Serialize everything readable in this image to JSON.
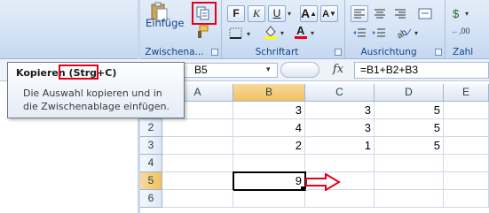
{
  "colors": {
    "ribbon": "#d4e3f6",
    "highlight": "#e3001b",
    "header_selected": "#f1c15f",
    "tooltip_border": "#767676"
  },
  "ribbon": {
    "clipboard": {
      "paste_label": "Einfüge",
      "group_label": "Zwischena..."
    },
    "font": {
      "group_label": "Schriftart",
      "bold": "F",
      "italic": "K",
      "underline": "U"
    },
    "alignment": {
      "group_label": "Ausrichtung"
    },
    "number": {
      "group_label": "Zahl",
      "label_00": ",00"
    }
  },
  "tooltip": {
    "title_prefix": "Kopieren ",
    "shortcut": "(Strg+C)",
    "description": "Die Auswahl kopieren und in die Zwischenablage einfügen."
  },
  "formula_bar": {
    "name_box": "B5",
    "fx": "fx",
    "formula": "=B1+B2+B3"
  },
  "sheet": {
    "columns": [
      "A",
      "B",
      "C",
      "D",
      "E"
    ],
    "rows": [
      {
        "num": "1",
        "cells": [
          "",
          "3",
          "3",
          "5",
          ""
        ]
      },
      {
        "num": "2",
        "cells": [
          "",
          "4",
          "3",
          "5",
          ""
        ]
      },
      {
        "num": "3",
        "cells": [
          "",
          "2",
          "1",
          "5",
          ""
        ]
      },
      {
        "num": "4",
        "cells": [
          "",
          "",
          "",
          "",
          ""
        ]
      },
      {
        "num": "5",
        "cells": [
          "",
          "9",
          "",
          "",
          ""
        ]
      },
      {
        "num": "6",
        "cells": [
          "",
          "",
          "",
          "",
          ""
        ]
      }
    ],
    "selected_cell": "B5"
  }
}
